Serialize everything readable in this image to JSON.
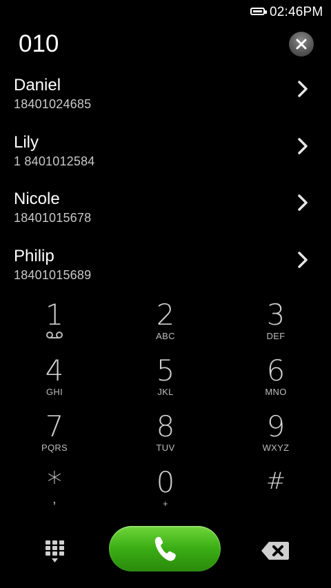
{
  "status_bar": {
    "time": "02:46PM",
    "battery_icon": "battery-icon"
  },
  "dialer": {
    "number": "010",
    "clear_icon": "clear-icon"
  },
  "contacts": [
    {
      "name": "Daniel",
      "number": "18401024685"
    },
    {
      "name": "Lily",
      "number": "1 8401012584"
    },
    {
      "name": "Nicole",
      "number": "18401015678"
    },
    {
      "name": "Philip",
      "number": "18401015689"
    }
  ],
  "keypad": [
    {
      "digit": "1",
      "letters": ""
    },
    {
      "digit": "2",
      "letters": "ABC"
    },
    {
      "digit": "3",
      "letters": "DEF"
    },
    {
      "digit": "4",
      "letters": "GHI"
    },
    {
      "digit": "5",
      "letters": "JKL"
    },
    {
      "digit": "6",
      "letters": "MNO"
    },
    {
      "digit": "7",
      "letters": "PQRS"
    },
    {
      "digit": "8",
      "letters": "TUV"
    },
    {
      "digit": "9",
      "letters": "WXYZ"
    },
    {
      "digit": "*",
      "letters": ","
    },
    {
      "digit": "0",
      "letters": "+"
    },
    {
      "digit": "#",
      "letters": ""
    }
  ],
  "bottom_bar": {
    "keypad_toggle_icon": "keypad-grid-icon",
    "call_icon": "phone-icon",
    "backspace_icon": "backspace-icon",
    "call_color": "#3aad14"
  }
}
